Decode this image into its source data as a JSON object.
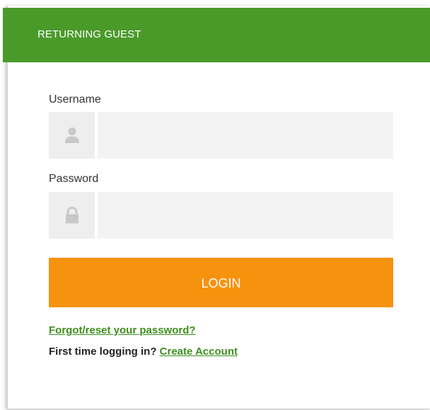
{
  "header": {
    "title": "RETURNING GUEST",
    "color": "#4a9a2a"
  },
  "username": {
    "label": "Username",
    "value": "",
    "placeholder": "",
    "icon": "user-icon"
  },
  "password": {
    "label": "Password",
    "value": "",
    "placeholder": "",
    "icon": "lock-icon"
  },
  "login": {
    "label": "LOGIN",
    "color": "#f7920f"
  },
  "links": {
    "forgot": "Forgot/reset your password?",
    "first_time_prompt": "First time logging in?",
    "create_account": "Create Account"
  }
}
